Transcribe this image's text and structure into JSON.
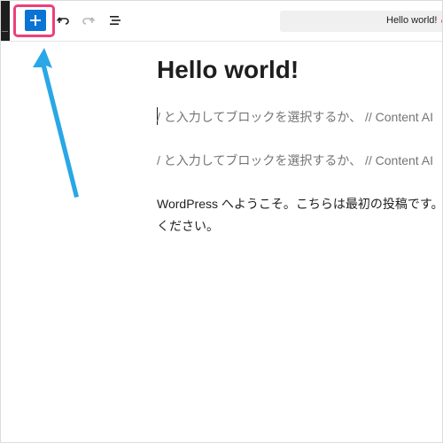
{
  "toolbar": {
    "inserter_label": "+",
    "document_bar_title": "Hello world!"
  },
  "icons": {
    "inserter": "plus-icon",
    "undo": "undo-icon",
    "redo": "redo-icon",
    "list_view": "list-view-icon",
    "annotation": "arrow-annotation-icon"
  },
  "colors": {
    "accent": "#0a74d4",
    "highlight": "#ee3f7a",
    "annotation_arrow": "#29a7e6",
    "placeholder_text": "#757575"
  },
  "editor": {
    "post_title": "Hello world!",
    "placeholder_1": "/ と入力してブロックを選択するか、 // Content AI",
    "placeholder_2": "/ と入力してブロックを選択するか、 // Content AI",
    "paragraph_line_1": "WordPress へようこそ。こちらは最初の投稿です。編",
    "paragraph_line_2": "ください。"
  }
}
